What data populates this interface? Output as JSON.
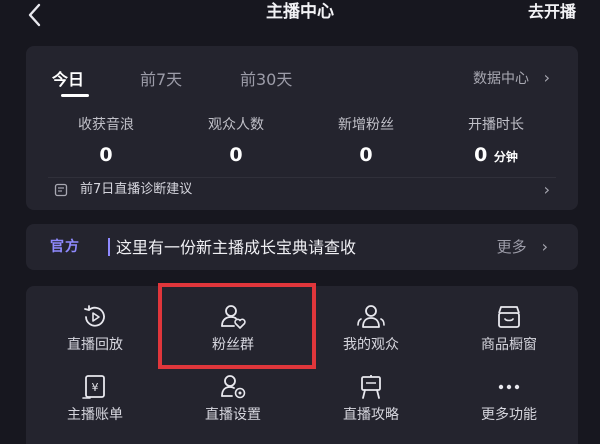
{
  "header": {
    "title": "主播中心",
    "go_live": "去开播"
  },
  "stats": {
    "tabs": [
      "今日",
      "前7天",
      "前30天"
    ],
    "active_tab": "今日",
    "data_center": "数据中心",
    "metrics": [
      {
        "label": "收获音浪",
        "value": "0",
        "unit": ""
      },
      {
        "label": "观众人数",
        "value": "0",
        "unit": ""
      },
      {
        "label": "新增粉丝",
        "value": "0",
        "unit": ""
      },
      {
        "label": "开播时长",
        "value": "0",
        "unit": "分钟"
      }
    ],
    "diagnosis": "前7日直播诊断建议"
  },
  "official": {
    "badge": "官方",
    "text": "这里有一份新主播成长宝典请查收",
    "more": "更多"
  },
  "tools": [
    {
      "label": "直播回放",
      "icon": "replay-icon"
    },
    {
      "label": "粉丝群",
      "icon": "fan-group-icon"
    },
    {
      "label": "我的观众",
      "icon": "audience-icon"
    },
    {
      "label": "商品橱窗",
      "icon": "shop-window-icon"
    },
    {
      "label": "主播账单",
      "icon": "bill-icon"
    },
    {
      "label": "直播设置",
      "icon": "live-settings-icon"
    },
    {
      "label": "直播攻略",
      "icon": "guide-icon"
    },
    {
      "label": "更多功能",
      "icon": "more-functions-icon"
    }
  ],
  "colors": {
    "background": "#17171f",
    "card": "#24242e",
    "official_accent": "#8f8aff",
    "highlight": "#e0363b"
  }
}
